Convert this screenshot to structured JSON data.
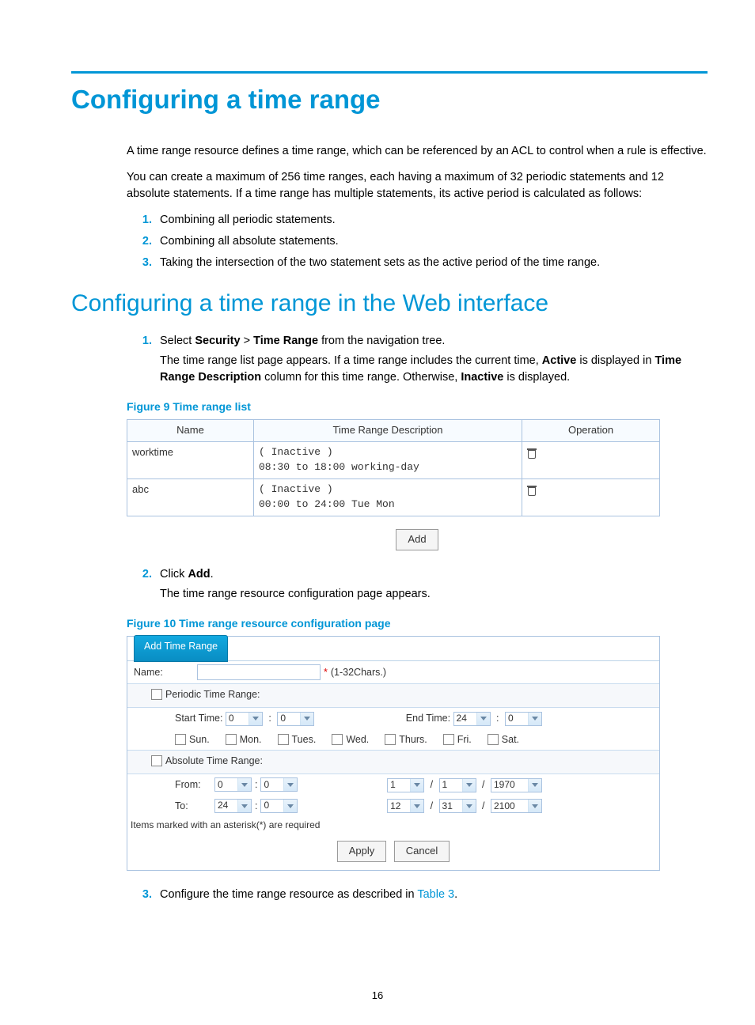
{
  "page_title": "Configuring a time range",
  "intro_p1": "A time range resource defines a time range, which can be referenced by an ACL to control when a rule is effective.",
  "intro_p2": "You can create a maximum of 256 time ranges, each having a maximum of 32 periodic statements and 12 absolute statements. If a time range has multiple statements, its active period is calculated as follows:",
  "intro_list": {
    "i1": "Combining all periodic statements.",
    "i2": "Combining all absolute statements.",
    "i3": "Taking the intersection of the two statement sets as the active period of the time range."
  },
  "h2": "Configuring a time range in the Web interface",
  "step1_pre": "Select ",
  "step1_sec": "Security",
  "step1_gt": " > ",
  "step1_tr": "Time Range",
  "step1_post": " from the navigation tree.",
  "step1_sub_a": "The time range list page appears. If a time range includes the current time, ",
  "step1_active": "Active",
  "step1_sub_b": " is displayed in ",
  "step1_trd": "Time Range Description",
  "step1_sub_c": " column for this time range. Otherwise, ",
  "step1_inactive": "Inactive",
  "step1_sub_d": " is displayed.",
  "fig9_caption": "Figure 9 Time range list",
  "table9": {
    "h_name": "Name",
    "h_desc": "Time Range Description",
    "h_op": "Operation",
    "r1_name": "worktime",
    "r1_desc_a": "( Inactive )",
    "r1_desc_b": "08:30 to 18:00 working-day",
    "r2_name": "abc",
    "r2_desc_a": "( Inactive )",
    "r2_desc_b": "00:00 to 24:00 Tue Mon"
  },
  "add_btn": "Add",
  "step2_pre": "Click ",
  "step2_add": "Add",
  "step2_post": ".",
  "step2_sub": "The time range resource configuration page appears.",
  "fig10_caption": "Figure 10 Time range resource configuration page",
  "cfg": {
    "tab": "Add Time Range",
    "name_label": "Name:",
    "name_hint": "(1-32Chars.)",
    "periodic_label": "Periodic Time Range:",
    "start_label": "Start Time:",
    "end_label": "End Time:",
    "start_h": "0",
    "start_m": "0",
    "end_h": "24",
    "end_m": "0",
    "days": {
      "sun": "Sun.",
      "mon": "Mon.",
      "tue": "Tues.",
      "wed": "Wed.",
      "thu": "Thurs.",
      "fri": "Fri.",
      "sat": "Sat."
    },
    "absolute_label": "Absolute Time Range:",
    "from_label": "From:",
    "to_label": "To:",
    "from_h": "0",
    "from_m": "0",
    "from_mo": "1",
    "from_d": "1",
    "from_y": "1970",
    "to_h": "24",
    "to_m": "0",
    "to_mo": "12",
    "to_d": "31",
    "to_y": "2100",
    "note": "Items marked with an asterisk(*) are required",
    "apply": "Apply",
    "cancel": "Cancel"
  },
  "step3_pre": "Configure the time range resource as described in ",
  "step3_link": "Table 3",
  "step3_post": ".",
  "page_number": "16"
}
